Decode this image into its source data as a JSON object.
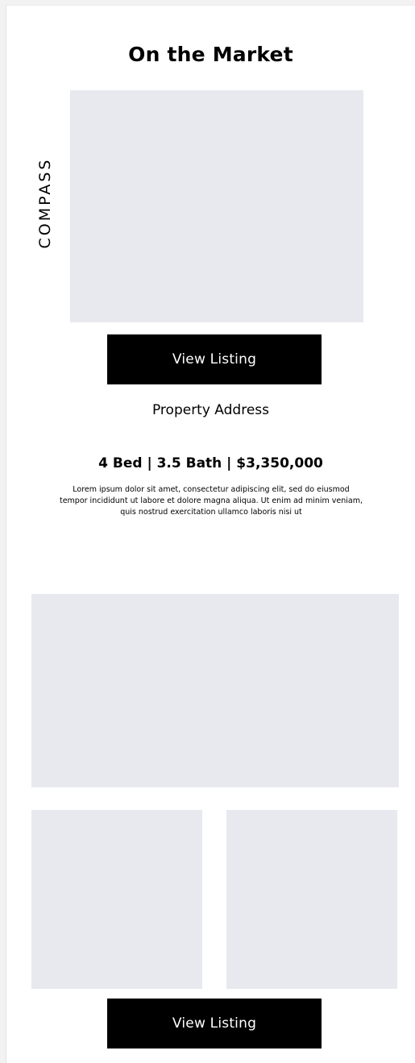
{
  "section": {
    "title": "On the Market",
    "logo": "COMPASS"
  },
  "listing": {
    "button_label": "View Listing",
    "address": "Property Address",
    "specs": "4 Bed | 3.5 Bath | $3,350,000",
    "description": "Lorem ipsum dolor sit amet, consectetur adipiscing elit, sed do eiusmod tempor incididunt ut labore et dolore magna aliqua. Ut enim ad minim veniam, quis nostrud exercitation ullamco laboris nisi ut"
  },
  "gallery": {
    "button_label": "View Listing"
  },
  "colors": {
    "placeholder": "#e8e9ef",
    "button_bg": "#000000",
    "button_text": "#ffffff"
  }
}
